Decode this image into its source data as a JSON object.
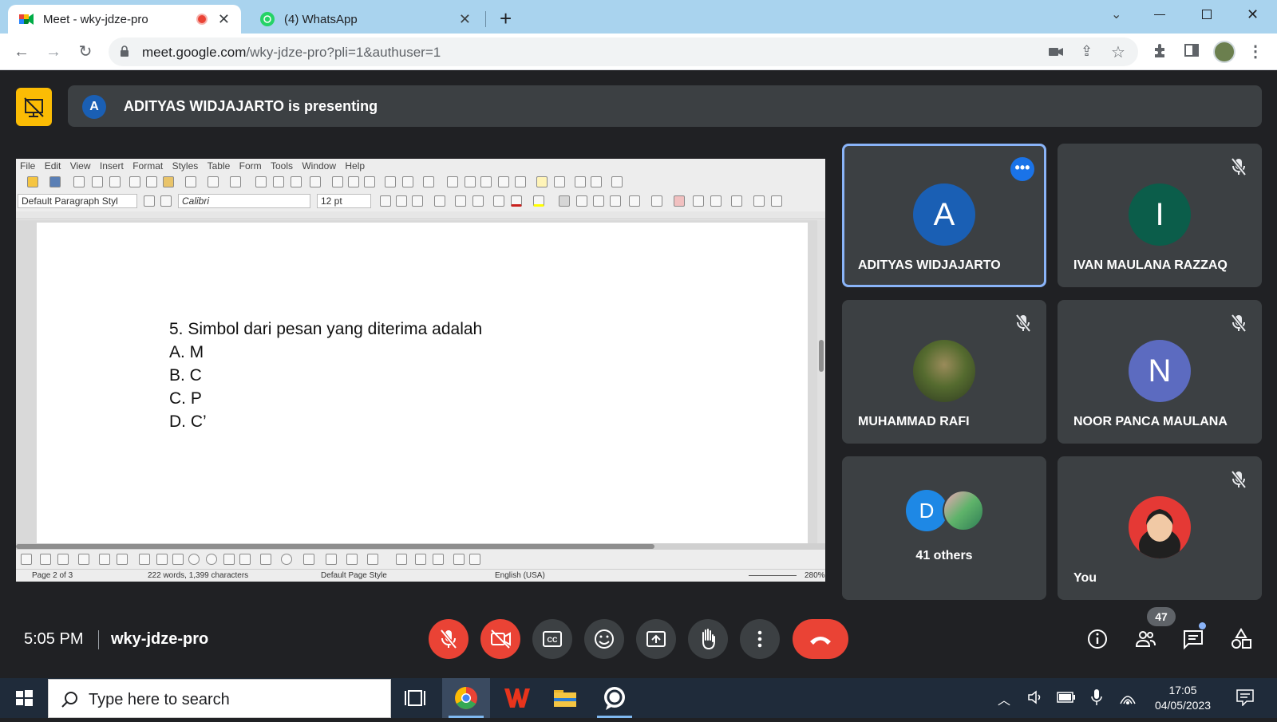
{
  "browser": {
    "tabs": [
      {
        "title": "Meet - wky-jdze-pro",
        "active": true
      },
      {
        "title": "(4) WhatsApp",
        "active": false
      }
    ],
    "url_host": "meet.google.com",
    "url_path": "/wky-jdze-pro?pli=1&authuser=1"
  },
  "meet": {
    "presenting_initial": "A",
    "presenting_text": "ADITYAS WIDJAJARTO is presenting",
    "participants": [
      {
        "name": "ADITYAS WIDJAJARTO",
        "initial": "A",
        "color": "#1a5fb4"
      },
      {
        "name": "IVAN MAULANA RAZZAQ",
        "initial": "I",
        "color": "#0b5d4a"
      },
      {
        "name": "MUHAMMAD RAFI",
        "initial": "",
        "color": "#556b2f"
      },
      {
        "name": "NOOR PANCA MAULANA",
        "initial": "N",
        "color": "#5c6bc0"
      },
      {
        "name": "41 others",
        "initial": "D",
        "color": "#1e88e5"
      },
      {
        "name": "You",
        "initial": "",
        "color": "#e53935"
      }
    ],
    "time": "5:05 PM",
    "meeting_code": "wky-jdze-pro",
    "people_count": "47"
  },
  "writer": {
    "menu": [
      "File",
      "Edit",
      "View",
      "Insert",
      "Format",
      "Styles",
      "Table",
      "Form",
      "Tools",
      "Window",
      "Help"
    ],
    "para_style": "Default Paragraph Styl",
    "font": "Calibri",
    "size": "12 pt",
    "doc_lines": [
      "5. Simbol dari pesan yang diterima adalah",
      "A. M",
      "B. C",
      "C. P",
      "D. C’"
    ],
    "status": {
      "page": "Page 2 of 3",
      "words": "222 words, 1,399 characters",
      "page_style": "Default Page Style",
      "language": "English (USA)",
      "zoom": "280%"
    }
  },
  "taskbar": {
    "search_placeholder": "Type here to search",
    "clock_time": "17:05",
    "clock_date": "04/05/2023"
  }
}
